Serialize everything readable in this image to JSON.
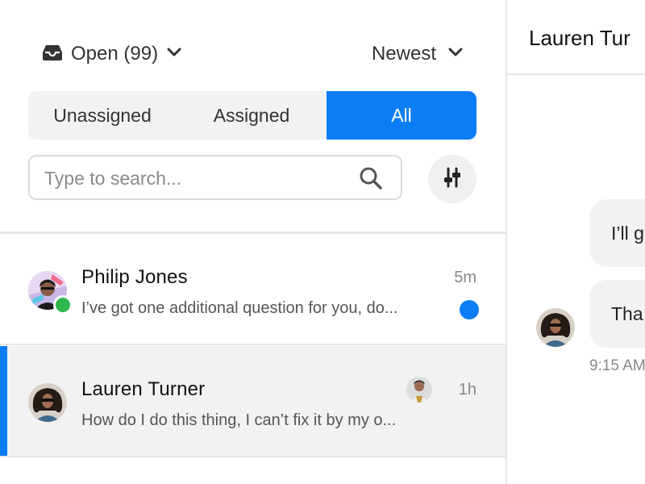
{
  "filters": {
    "status_label": "Open (99)",
    "sort_label": "Newest"
  },
  "tabs": [
    {
      "label": "Unassigned",
      "active": false
    },
    {
      "label": "Assigned",
      "active": false
    },
    {
      "label": "All",
      "active": true
    }
  ],
  "search": {
    "placeholder": "Type to search...",
    "value": ""
  },
  "conversations": [
    {
      "name": "Philip Jones",
      "snippet": "I’ve got one additional question for you, do...",
      "time": "5m",
      "online": true,
      "unread": true,
      "selected": false
    },
    {
      "name": "Lauren Turner",
      "snippet": "How do I do this thing, I can’t fix it by my o...",
      "time": "1h",
      "online": false,
      "unread": false,
      "selected": true
    }
  ],
  "chat": {
    "title": "Lauren Tur",
    "messages": [
      {
        "text": "I’ll g",
        "from": "agent"
      },
      {
        "text": "Tha",
        "from": "customer"
      }
    ],
    "last_time": "9:15 AM"
  },
  "colors": {
    "accent": "#0b7ef6",
    "online": "#2fb84e",
    "surface": "#f2f2f2"
  }
}
